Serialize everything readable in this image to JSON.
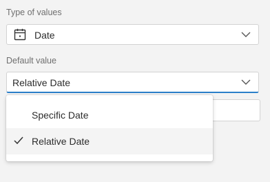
{
  "type_of_values": {
    "label": "Type of values",
    "value": "Date",
    "icon": "calendar-icon"
  },
  "default_value": {
    "label": "Default value",
    "value": "Relative Date"
  },
  "dropdown": {
    "options": [
      {
        "label": "Specific Date",
        "selected": false
      },
      {
        "label": "Relative Date",
        "selected": true
      }
    ]
  },
  "colors": {
    "accent": "#2a7fc9",
    "background": "#f3f3f3"
  }
}
